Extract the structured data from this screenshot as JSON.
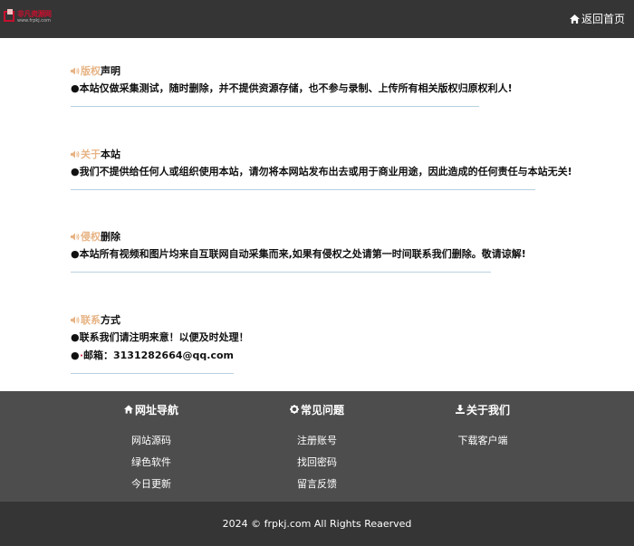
{
  "header": {
    "logo_text": "非凡资源网",
    "logo_subtext": "www.frpkj.com",
    "home_link": "返回首页"
  },
  "sections": [
    {
      "title_highlight": "版权",
      "title_rest": "声明",
      "lines": [
        "●本站仅做采集测试，随时删除，并不提供资源存储，也不参与录制、上传所有相关版权归原权利人!"
      ]
    },
    {
      "title_highlight": "关于",
      "title_rest": "本站",
      "lines": [
        "●我们不提供给任何人或组织使用本站，请勿将本网站发布出去或用于商业用途，因此造成的任何责任与本站无关!"
      ]
    },
    {
      "title_highlight": "侵权",
      "title_rest": "删除",
      "lines": [
        "●本站所有视频和图片均来自互联网自动采集而来,如果有侵权之处请第一时间联系我们删除。敬请谅解!"
      ]
    },
    {
      "title_highlight": "联系",
      "title_rest": "方式",
      "lines": [
        "●联系我们请注明来意！以便及时处理！"
      ],
      "email_prefix": "●",
      "email": "邮箱：3131282664@qq.com"
    }
  ],
  "footer": {
    "columns": [
      {
        "title": "网址导航",
        "icon": "home-icon",
        "links": [
          "网站源码",
          "绿色软件",
          "今日更新"
        ]
      },
      {
        "title": "常见问题",
        "icon": "gear-icon",
        "links": [
          "注册账号",
          "找回密码",
          "留言反馈"
        ]
      },
      {
        "title": "关于我们",
        "icon": "download-icon",
        "links": [
          "下载客户端"
        ]
      }
    ],
    "copyright": "2024 © frpkj.com All Rights Reaerved"
  },
  "colors": {
    "highlight": "#e7b485",
    "header_bg": "#353535",
    "footer_bg": "#4d4d4d",
    "rule": "#b9d0df",
    "email_icon": "#c8102e"
  }
}
